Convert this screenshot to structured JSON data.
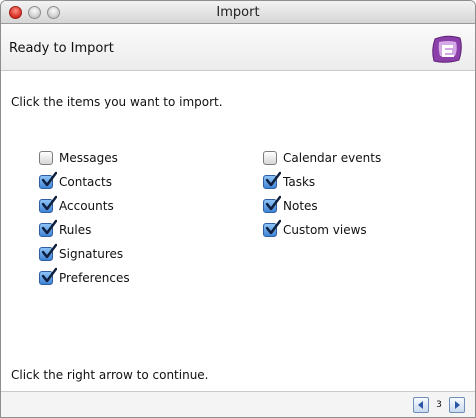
{
  "window": {
    "title": "Import"
  },
  "header": {
    "title": "Ready to Import",
    "logo_icon": "entourage-logo-icon"
  },
  "instruction": "Click the items you want to import.",
  "items_left": [
    {
      "label": "Messages",
      "checked": false
    },
    {
      "label": "Contacts",
      "checked": true
    },
    {
      "label": "Accounts",
      "checked": true
    },
    {
      "label": "Rules",
      "checked": true
    },
    {
      "label": "Signatures",
      "checked": true
    },
    {
      "label": "Preferences",
      "checked": true
    }
  ],
  "items_right": [
    {
      "label": "Calendar events",
      "checked": false
    },
    {
      "label": "Tasks",
      "checked": true
    },
    {
      "label": "Notes",
      "checked": true
    },
    {
      "label": "Custom views",
      "checked": true
    }
  ],
  "footer": {
    "text": "Click the right arrow to continue.",
    "page": "3",
    "prev_icon": "left-arrow-icon",
    "next_icon": "right-arrow-icon"
  },
  "colors": {
    "checkbox_checked": "#3f84d6",
    "logo": "#8b3fa8"
  }
}
